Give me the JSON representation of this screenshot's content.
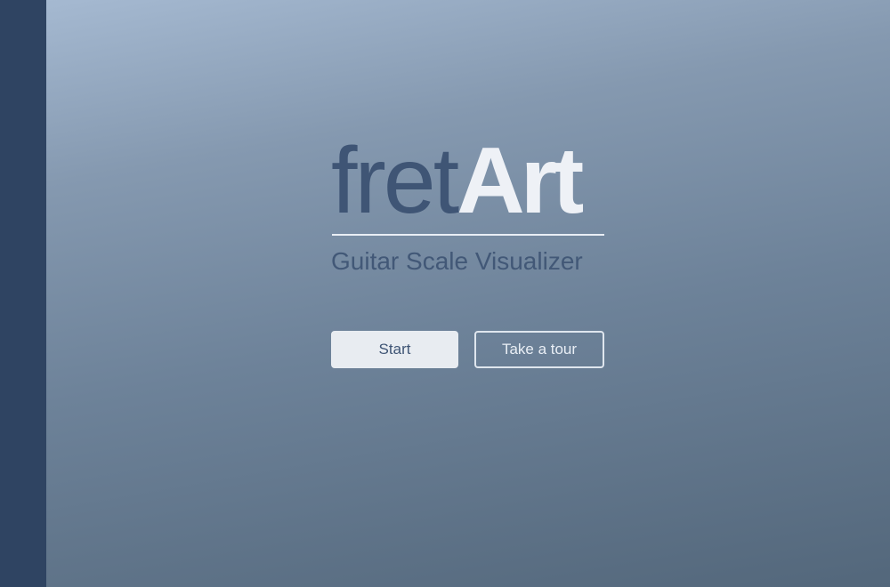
{
  "app": {
    "logo_light": "fret",
    "logo_bold": "Art",
    "tagline": "Guitar Scale Visualizer"
  },
  "actions": {
    "start_label": "Start",
    "tour_label": "Take a tour"
  },
  "colors": {
    "sidebar": "#2f4462",
    "logo_dark": "#3f5575",
    "logo_light": "#eef1f6",
    "background_top": "#a5b9d1",
    "background_bottom": "#53677b"
  }
}
